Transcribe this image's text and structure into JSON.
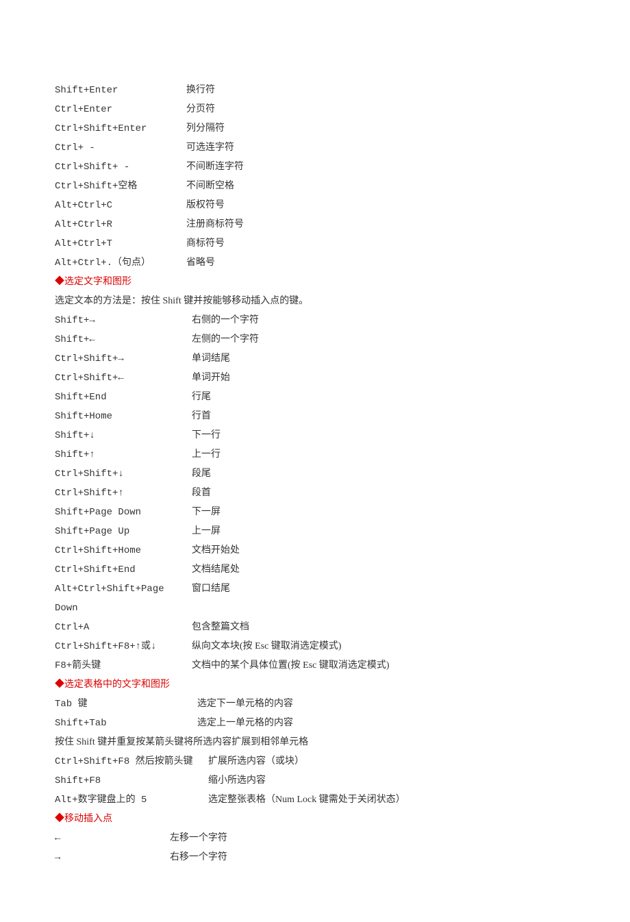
{
  "section1": [
    {
      "k": "Shift+Enter",
      "d": "换行符"
    },
    {
      "k": "Ctrl+Enter",
      "d": "分页符"
    },
    {
      "k": "Ctrl+Shift+Enter",
      "d": "列分隔符"
    },
    {
      "k": "Ctrl+ -",
      "d": "可选连字符"
    },
    {
      "k": "Ctrl+Shift+ -",
      "d": "不间断连字符"
    },
    {
      "k": "Ctrl+Shift+空格",
      "d": "不间断空格"
    },
    {
      "k": "Alt+Ctrl+C",
      "d": "版权符号"
    },
    {
      "k": "Alt+Ctrl+R",
      "d": "注册商标符号"
    },
    {
      "k": "Alt+Ctrl+T",
      "d": "商标符号"
    },
    {
      "k": "Alt+Ctrl+.（句点）",
      "d": "省略号"
    }
  ],
  "heading1": "◆选定文字和图形",
  "note1": "选定文本的方法是：按住 Shift 键并按能够移动插入点的键。",
  "section2": [
    {
      "k": "Shift+→",
      "d": "右侧的一个字符"
    },
    {
      "k": "Shift+←",
      "d": "左侧的一个字符"
    },
    {
      "k": "Ctrl+Shift+→",
      "d": "单词结尾"
    },
    {
      "k": "Ctrl+Shift+←",
      "d": "单词开始"
    },
    {
      "k": "Shift+End",
      "d": "行尾"
    },
    {
      "k": "Shift+Home",
      "d": "行首"
    },
    {
      "k": "Shift+↓",
      "d": "下一行"
    },
    {
      "k": "Shift+↑",
      "d": "上一行"
    },
    {
      "k": "Ctrl+Shift+↓",
      "d": "段尾"
    },
    {
      "k": "Ctrl+Shift+↑",
      "d": "段首"
    },
    {
      "k": "Shift+Page Down",
      "d": "下一屏"
    },
    {
      "k": "Shift+Page Up",
      "d": "上一屏"
    },
    {
      "k": "Ctrl+Shift+Home",
      "d": "文档开始处"
    },
    {
      "k": "Ctrl+Shift+End",
      "d": "文档结尾处"
    },
    {
      "k": "Alt+Ctrl+Shift+Page Down",
      "d": "窗口结尾"
    },
    {
      "k": "Ctrl+A",
      "d": "包含整篇文档"
    },
    {
      "k": "Ctrl+Shift+F8+↑或↓",
      "d": "纵向文本块(按 Esc 键取消选定模式)"
    },
    {
      "k": "F8+箭头键",
      "d": "文档中的某个具体位置(按 Esc 键取消选定模式)"
    }
  ],
  "heading2": "◆选定表格中的文字和图形",
  "section3a": [
    {
      "k": "Tab 键",
      "d": "选定下一单元格的内容"
    },
    {
      "k": "Shift+Tab",
      "d": "选定上一单元格的内容"
    }
  ],
  "note2": "按住 Shift 键并重复按某箭头键将所选内容扩展到相邻单元格",
  "section3b": [
    {
      "k": "Ctrl+Shift+F8 然后按箭头键",
      "d": "扩展所选内容（或块）"
    },
    {
      "k": "Shift+F8",
      "d": "缩小所选内容"
    },
    {
      "k": "Alt+数字键盘上的 5",
      "d": "选定整张表格（Num Lock 键需处于关闭状态）"
    }
  ],
  "heading3": "◆移动插入点",
  "section4": [
    {
      "k": "←",
      "d": "左移一个字符"
    },
    {
      "k": "→",
      "d": "右移一个字符"
    }
  ]
}
